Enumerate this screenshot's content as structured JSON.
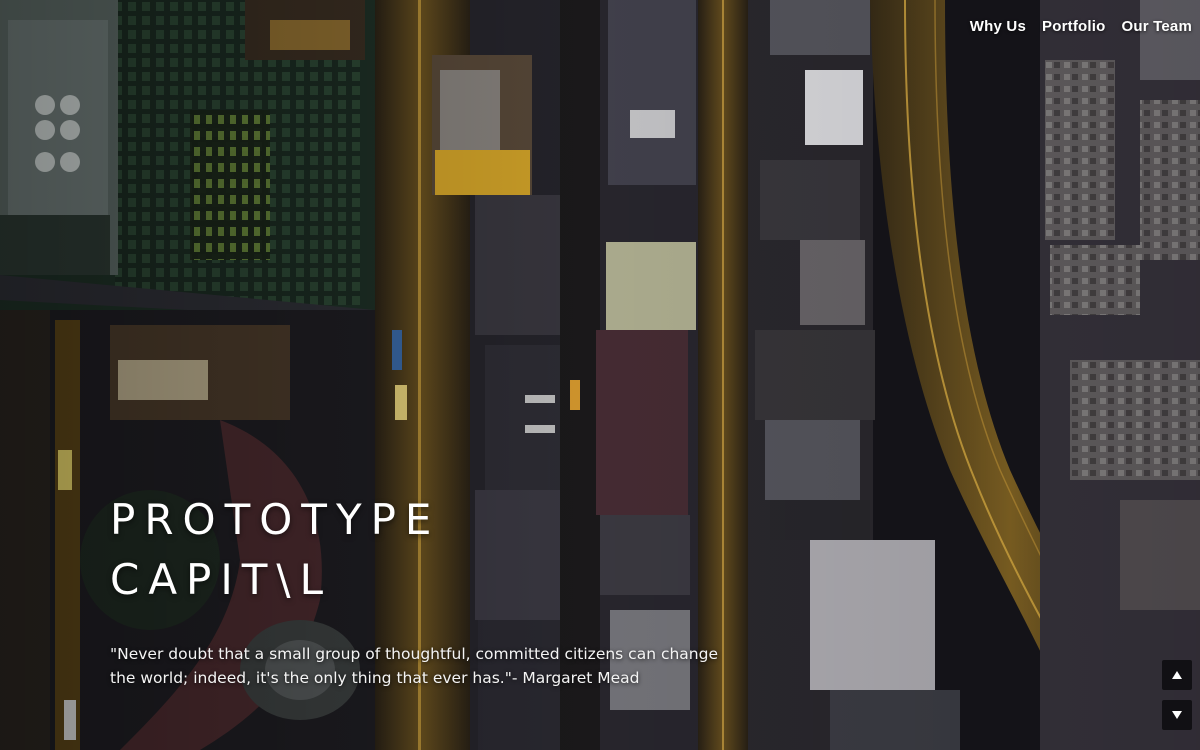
{
  "nav": {
    "items": [
      {
        "label": "Why Us"
      },
      {
        "label": "Portfolio"
      },
      {
        "label": "Our Team"
      }
    ]
  },
  "hero": {
    "title_line1": "PROTOTYPE",
    "title_line2": "CAPIT\\L",
    "quote": "\"Never doubt that a small group of thoughtful, committed citizens can change the world; indeed, it's the only thing that ever has.\"- Margaret Mead"
  },
  "controls": {
    "up_icon": "triangle-up-icon",
    "down_icon": "triangle-down-icon"
  },
  "colors": {
    "text": "#ffffff",
    "streetlight": "#e8b030",
    "background": "#121219"
  }
}
